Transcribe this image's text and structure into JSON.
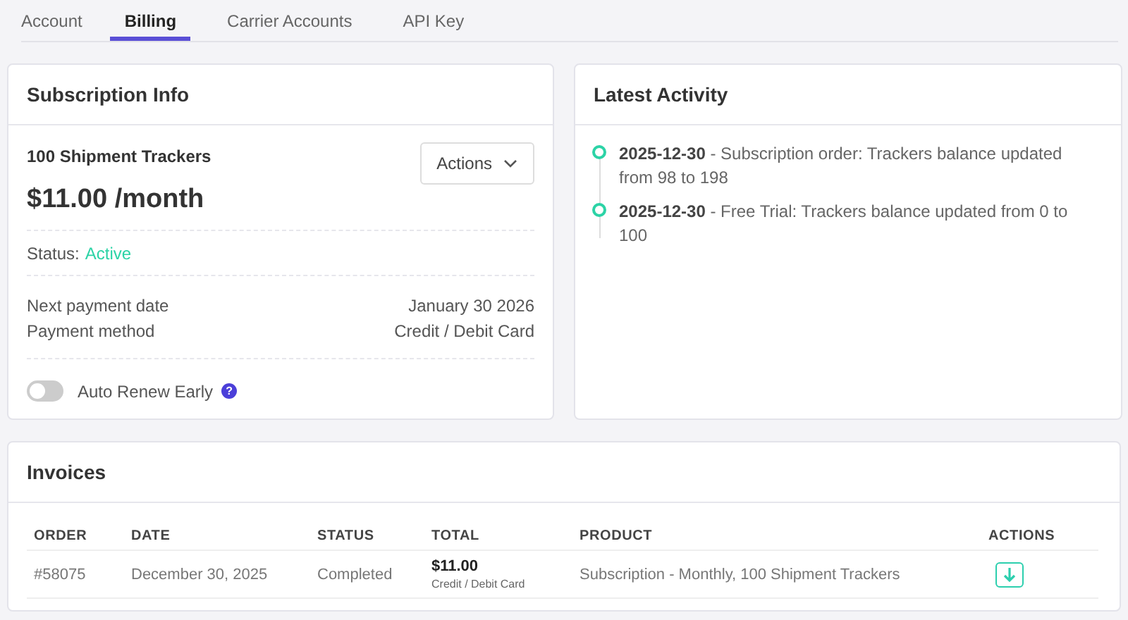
{
  "tabs": [
    {
      "label": "Account",
      "selected": false
    },
    {
      "label": "Billing",
      "selected": true
    },
    {
      "label": "Carrier Accounts",
      "selected": false
    },
    {
      "label": "API Key",
      "selected": false
    }
  ],
  "subscription": {
    "title": "Subscription Info",
    "plan": "100 Shipment Trackers",
    "price": "$11.00 /month",
    "actions_button": "Actions",
    "status_label": "Status:",
    "status_value": "Active",
    "details": [
      {
        "label": "Next payment date",
        "value": "January 30 2026"
      },
      {
        "label": "Payment method",
        "value": "Credit / Debit Card"
      }
    ],
    "auto_renew": {
      "label": "Auto Renew Early",
      "on": false,
      "help": "?"
    }
  },
  "activity": {
    "title": "Latest Activity",
    "items": [
      {
        "text": "**2025-12-30** - Subscription order: Trackers balance updated from 98 to 198"
      },
      {
        "text": "**2025-12-30** - Free Trial: Trackers balance updated from 0 to 100"
      }
    ]
  },
  "invoices": {
    "title": "Invoices",
    "columns": [
      "ORDER",
      "DATE",
      "STATUS",
      "TOTAL",
      "PRODUCT",
      "ACTIONS"
    ],
    "rows": [
      {
        "order": "#58075",
        "date": "December 30, 2025",
        "status": "Completed",
        "total": "$11.00",
        "method": "Credit / Debit Card",
        "product": "Subscription - Monthly, 100 Shipment Trackers"
      }
    ]
  }
}
